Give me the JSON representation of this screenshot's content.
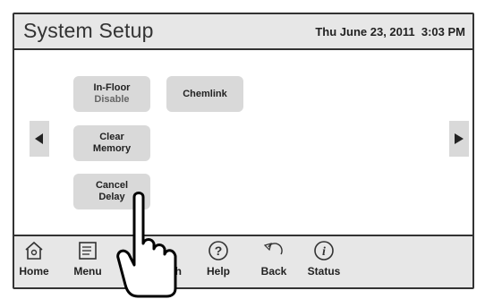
{
  "header": {
    "title": "System Setup",
    "datetime": "Thu June 23, 2011  3:03 PM"
  },
  "buttons": {
    "infloor": {
      "line1": "In-Floor",
      "line2": "Disable"
    },
    "chemlink": {
      "label": "Chemlink"
    },
    "clear_memory": {
      "line1": "Clear",
      "line2": "Memory"
    },
    "cancel_delay": {
      "line1": "Cancel",
      "line2": "Delay"
    }
  },
  "footer": {
    "items": [
      {
        "label": "Home",
        "icon": "home-icon"
      },
      {
        "label": "Menu",
        "icon": "menu-icon"
      },
      {
        "label": "ch",
        "icon": "touch-icon"
      },
      {
        "label": "Help",
        "icon": "help-icon"
      },
      {
        "label": "Back",
        "icon": "back-icon"
      },
      {
        "label": "Status",
        "icon": "status-icon"
      }
    ]
  },
  "colors": {
    "panel": "#e7e7e7",
    "button": "#d9d9d9",
    "border": "#333333"
  }
}
